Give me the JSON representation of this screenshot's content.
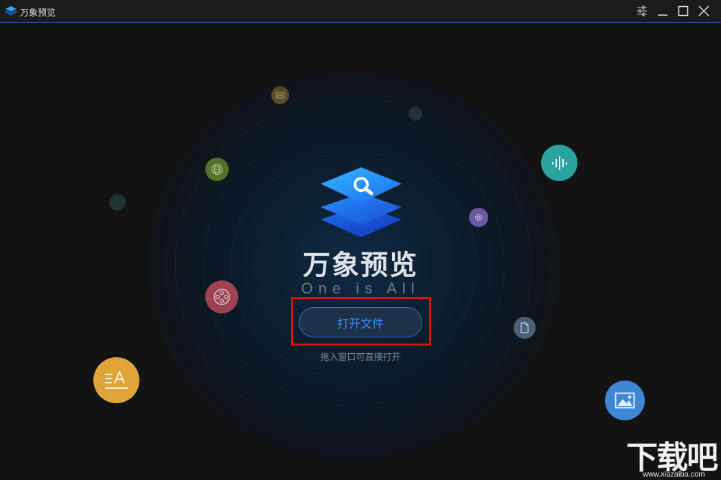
{
  "window": {
    "title": "万象预览",
    "controls": [
      "settings-icon",
      "minimize-icon",
      "maximize-icon",
      "close-icon"
    ]
  },
  "main": {
    "brand_name": "万象预览",
    "slogan": "One is All",
    "open_button_label": "打开文件",
    "hint": "拖入窗口可直接打开"
  },
  "bubbles": [
    {
      "icon": "document-icon",
      "color": "#6b5a2c"
    },
    {
      "icon": "dot-icon",
      "color": "#25303c"
    },
    {
      "icon": "globe-icon",
      "color": "#5f7a2e"
    },
    {
      "icon": "dot-icon",
      "color": "#1f3330"
    },
    {
      "icon": "audio-wave-icon",
      "color": "#2aa3a0"
    },
    {
      "icon": "settings-gear-icon",
      "color": "#6a5aa0"
    },
    {
      "icon": "film-reel-icon",
      "color": "#b84a5c"
    },
    {
      "icon": "file-icon",
      "color": "#4b6076"
    },
    {
      "icon": "text-font-icon",
      "color": "#e0a53a"
    },
    {
      "icon": "image-icon",
      "color": "#3f86d6"
    }
  ],
  "watermark": {
    "text": "下载吧",
    "url": "www.xiazaiba.com"
  },
  "colors": {
    "accent": "#3a86ff",
    "highlight": "#e00d0d",
    "title_border": "#2d62b8"
  }
}
